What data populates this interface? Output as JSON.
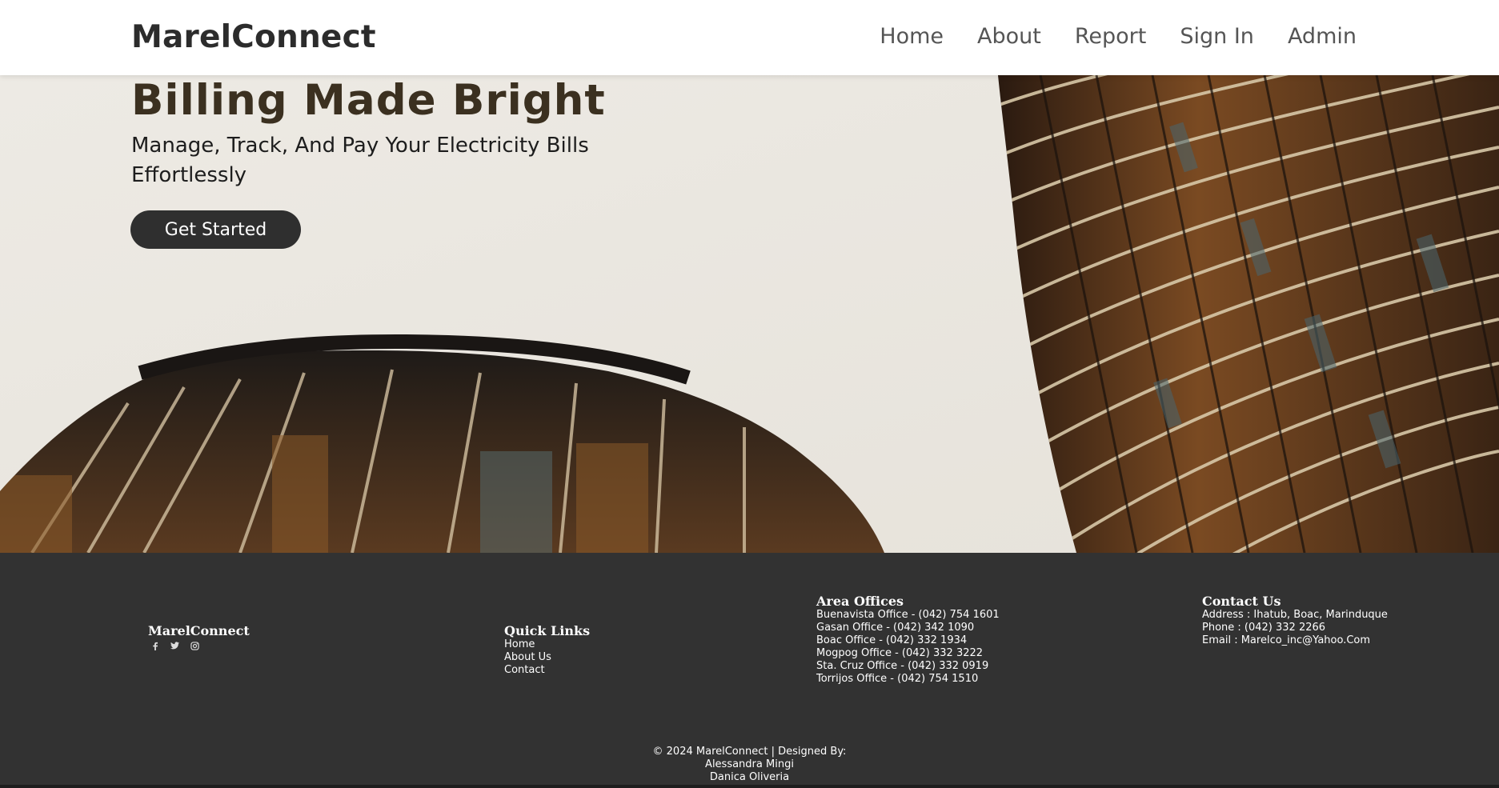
{
  "header": {
    "brand": "MarelConnect",
    "nav": [
      "Home",
      "About",
      "Report",
      "Sign In",
      "Admin"
    ]
  },
  "hero": {
    "title": "Billing Made Bright",
    "subtitle": "Manage, Track, And Pay Your Electricity Bills Effortlessly",
    "cta": "Get Started"
  },
  "footer": {
    "brand": "MarelConnect",
    "socials": [
      "facebook-icon",
      "twitter-icon",
      "instagram-icon"
    ],
    "quick_links": {
      "title": "Quick Links",
      "items": [
        "Home",
        "About Us",
        "Contact"
      ]
    },
    "area_offices": {
      "title": "Area Offices",
      "items": [
        "Buenavista Office - (042) 754 1601",
        "Gasan Office - (042) 342 1090",
        "Boac Office - (042) 332 1934",
        "Mogpog Office - (042) 332 3222",
        "Sta. Cruz Office - (042) 332 0919",
        "Torrijos Office - (042) 754 1510"
      ]
    },
    "contact": {
      "title": "Contact Us",
      "address": "Address : Ihatub, Boac, Marinduque",
      "phone": "Phone : (042) 332 2266",
      "email": "Email : Marelco_inc@Yahoo.Com"
    },
    "copyright": "© 2024 MarelConnect | Designed By:",
    "designers": [
      "Alessandra Mingi",
      "Danica Oliveria"
    ]
  },
  "colors": {
    "header_bg": "#ffffff",
    "hero_bg": "#ebe8e2",
    "hero_title": "#3b3020",
    "button_bg": "#2f2f2f",
    "footer_bg": "#323232"
  }
}
